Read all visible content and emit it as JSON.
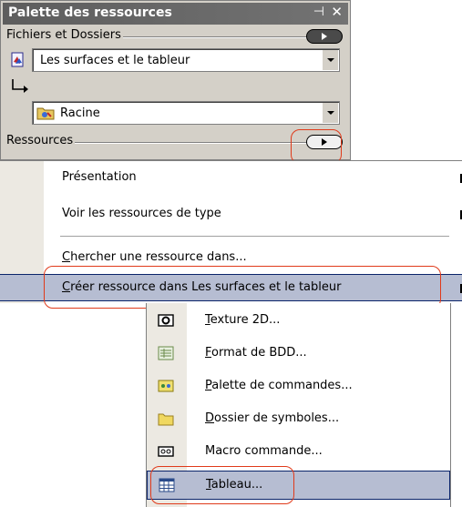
{
  "palette": {
    "title": "Palette des ressources",
    "pin_glyph": "⊣",
    "close_glyph": "✕",
    "files_section_label": "Fichiers et Dossiers",
    "document_select_value": "Les surfaces et le tableur",
    "folder_select_value": "Racine",
    "resources_section_label": "Ressources"
  },
  "menu": {
    "items": [
      {
        "label": "Présentation",
        "has_submenu": true
      },
      {
        "label": "Voir les ressources de type",
        "has_submenu": true
      },
      {
        "label": "Chercher une ressource dans...",
        "mnemonic": "C",
        "rest": "hercher une ressource dans..."
      },
      {
        "label": "Créer ressource dans  Les surfaces et le tableur",
        "mnemonic": "C",
        "rest": "réer ressource dans  Les surfaces et le tableur",
        "has_submenu": true
      }
    ]
  },
  "submenu": {
    "items": [
      {
        "mnemonic": "T",
        "rest": "exture 2D...",
        "icon": "texture-icon"
      },
      {
        "mnemonic": "F",
        "rest": "ormat de BDD...",
        "icon": "database-format-icon"
      },
      {
        "mnemonic": "P",
        "rest": "alette de commandes...",
        "icon": "command-palette-icon"
      },
      {
        "mnemonic": "D",
        "rest": "ossier de symboles...",
        "icon": "folder-icon"
      },
      {
        "mnemonic": "",
        "rest": "Macro commande...",
        "icon": "macro-icon"
      },
      {
        "mnemonic": "T",
        "rest": "ableau...",
        "icon": "table-icon"
      }
    ]
  },
  "colors": {
    "highlight": "#b6bdd2",
    "annotation_ring": "#e03a1a"
  }
}
